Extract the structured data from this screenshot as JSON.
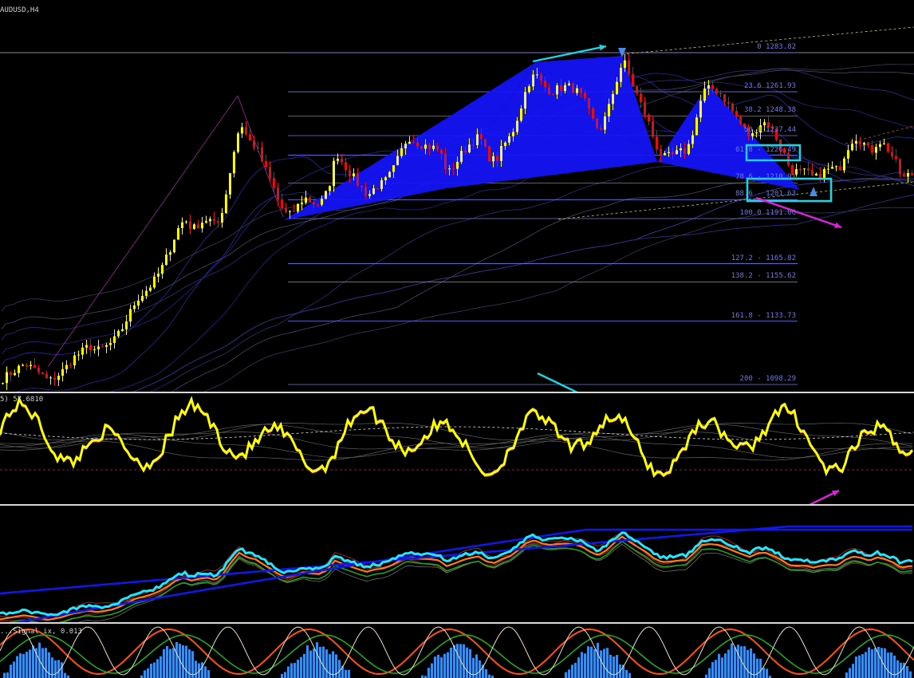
{
  "window": {
    "symbol_title": "AUDUSD,H4",
    "rsi_label": "5) 57.6810",
    "osma_label": "...Signal ix, 0.013"
  },
  "colors": {
    "bull_candle": "#ffff00",
    "bear_candle": "#e01010",
    "pattern_fill": "#1414f5",
    "fib_line": "#6e78e6",
    "annot_cyan": "#18d8e8",
    "annot_magenta": "#e020e0",
    "rsi_line": "#ffff00",
    "ma_cyan": "#20e8ff",
    "ma_blue": "#1018e8",
    "histogram": "#3b8ee6",
    "separator": "#d8d8d8"
  },
  "chart_data": {
    "type": "candlestick",
    "symbol": "AUDUSD",
    "timeframe": "H4",
    "fib_levels": [
      {
        "label": "0 1283.82",
        "level": "0",
        "price": 1283.82
      },
      {
        "label": "23.6 1261.93",
        "level": "23.6",
        "price": 1261.93
      },
      {
        "label": "38.2 1248.38",
        "level": "38.2",
        "price": 1248.38
      },
      {
        "label": "50.0 1237.44",
        "level": "50.0",
        "price": 1237.44
      },
      {
        "label": "61.8 - 1226.49",
        "level": "61.8",
        "price": 1226.49
      },
      {
        "label": "78.6 - 1210.91",
        "level": "78.6",
        "price": 1210.91
      },
      {
        "label": "88.6 - 1201.63",
        "level": "88.6",
        "price": 1201.63
      },
      {
        "label": "100.0 1191.06",
        "level": "100.0",
        "price": 1191.06
      },
      {
        "label": "127.2 - 1165.82",
        "level": "127.2",
        "price": 1165.82
      },
      {
        "label": "138.2 - 1155.62",
        "level": "138.2",
        "price": 1155.62
      },
      {
        "label": "161.8 - 1133.73",
        "level": "161.8",
        "price": 1133.73
      },
      {
        "label": "200 - 1098.29",
        "level": "200",
        "price": 1098.29
      }
    ],
    "price_path": [
      [
        0,
        1101
      ],
      [
        10,
        1104
      ],
      [
        20,
        1107
      ],
      [
        30,
        1110
      ],
      [
        40,
        1107
      ],
      [
        50,
        1104
      ],
      [
        60,
        1100
      ],
      [
        70,
        1103
      ],
      [
        80,
        1107
      ],
      [
        90,
        1113
      ],
      [
        100,
        1116
      ],
      [
        110,
        1120
      ],
      [
        120,
        1117
      ],
      [
        130,
        1119
      ],
      [
        140,
        1122
      ],
      [
        150,
        1128
      ],
      [
        160,
        1137
      ],
      [
        170,
        1146
      ],
      [
        180,
        1150
      ],
      [
        190,
        1155
      ],
      [
        200,
        1162
      ],
      [
        210,
        1172
      ],
      [
        220,
        1184
      ],
      [
        230,
        1191
      ],
      [
        240,
        1185
      ],
      [
        250,
        1189
      ],
      [
        260,
        1191
      ],
      [
        270,
        1186
      ],
      [
        280,
        1200
      ],
      [
        290,
        1225
      ],
      [
        300,
        1245
      ],
      [
        310,
        1235
      ],
      [
        320,
        1231
      ],
      [
        330,
        1220
      ],
      [
        340,
        1210
      ],
      [
        350,
        1198
      ],
      [
        360,
        1192
      ],
      [
        370,
        1197
      ],
      [
        380,
        1203
      ],
      [
        390,
        1200
      ],
      [
        400,
        1199
      ],
      [
        410,
        1207
      ],
      [
        420,
        1228
      ],
      [
        430,
        1221
      ],
      [
        440,
        1215
      ],
      [
        450,
        1209
      ],
      [
        460,
        1204
      ],
      [
        470,
        1209
      ],
      [
        480,
        1211
      ],
      [
        490,
        1217
      ],
      [
        500,
        1227
      ],
      [
        510,
        1237
      ],
      [
        520,
        1234
      ],
      [
        530,
        1232
      ],
      [
        540,
        1231
      ],
      [
        550,
        1229
      ],
      [
        560,
        1216
      ],
      [
        570,
        1222
      ],
      [
        580,
        1229
      ],
      [
        590,
        1234
      ],
      [
        600,
        1237
      ],
      [
        610,
        1226
      ],
      [
        620,
        1223
      ],
      [
        630,
        1232
      ],
      [
        640,
        1238
      ],
      [
        650,
        1251
      ],
      [
        660,
        1266
      ],
      [
        670,
        1272
      ],
      [
        680,
        1265
      ],
      [
        690,
        1262
      ],
      [
        700,
        1264
      ],
      [
        710,
        1265
      ],
      [
        720,
        1263
      ],
      [
        730,
        1258
      ],
      [
        740,
        1247
      ],
      [
        750,
        1240
      ],
      [
        760,
        1250
      ],
      [
        770,
        1266
      ],
      [
        780,
        1280
      ],
      [
        790,
        1268
      ],
      [
        800,
        1257
      ],
      [
        810,
        1247
      ],
      [
        820,
        1233
      ],
      [
        830,
        1225
      ],
      [
        840,
        1226
      ],
      [
        850,
        1228
      ],
      [
        860,
        1229
      ],
      [
        870,
        1244
      ],
      [
        880,
        1262
      ],
      [
        890,
        1264
      ],
      [
        900,
        1262
      ],
      [
        910,
        1256
      ],
      [
        920,
        1249
      ],
      [
        930,
        1242
      ],
      [
        940,
        1236
      ],
      [
        950,
        1244
      ],
      [
        960,
        1245
      ],
      [
        970,
        1238
      ],
      [
        980,
        1229
      ],
      [
        990,
        1218
      ],
      [
        1000,
        1217
      ],
      [
        1010,
        1217
      ],
      [
        1020,
        1213
      ],
      [
        1030,
        1217
      ],
      [
        1040,
        1219
      ],
      [
        1050,
        1218
      ],
      [
        1060,
        1230
      ],
      [
        1070,
        1237
      ],
      [
        1080,
        1234
      ],
      [
        1090,
        1228
      ],
      [
        1100,
        1235
      ],
      [
        1110,
        1231
      ],
      [
        1120,
        1224
      ],
      [
        1130,
        1213
      ],
      [
        1140,
        1216
      ]
    ]
  }
}
